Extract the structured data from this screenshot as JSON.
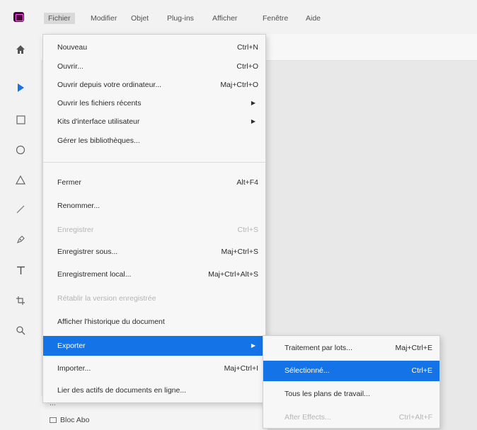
{
  "menubar": {
    "items": [
      "Fichier",
      "Modifier",
      "Objet",
      "Plug-ins",
      "Afficher",
      "Fenêtre",
      "Aide"
    ]
  },
  "tools": [
    "home-icon",
    "select-arrow-icon",
    "rectangle-icon",
    "ellipse-icon",
    "polygon-icon",
    "line-icon",
    "pen-icon",
    "text-icon",
    "artboard-icon",
    "zoom-icon"
  ],
  "layers": {
    "partial": "...",
    "item": "Bloc Abo"
  },
  "file_menu": {
    "items": [
      {
        "label": "Nouveau",
        "shortcut": "Ctrl+N"
      },
      {
        "label": "Ouvrir...",
        "shortcut": "Ctrl+O"
      },
      {
        "label": "Ouvrir depuis votre ordinateur...",
        "shortcut": "Maj+Ctrl+O"
      },
      {
        "label": "Ouvrir les fichiers récents",
        "shortcut": ""
      },
      {
        "label": "Kits d'interface utilisateur",
        "shortcut": ""
      },
      {
        "label": "Gérer les bibliothèques...",
        "shortcut": ""
      },
      {
        "label": "Fermer",
        "shortcut": "Alt+F4"
      },
      {
        "label": "Renommer...",
        "shortcut": ""
      },
      {
        "label": "Enregistrer",
        "shortcut": "Ctrl+S"
      },
      {
        "label": "Enregistrer sous...",
        "shortcut": "Maj+Ctrl+S"
      },
      {
        "label": "Enregistrement local...",
        "shortcut": "Maj+Ctrl+Alt+S"
      },
      {
        "label": "Rétablir la version enregistrée",
        "shortcut": ""
      },
      {
        "label": "Afficher l'historique du document",
        "shortcut": ""
      },
      {
        "label": "Exporter",
        "shortcut": ""
      },
      {
        "label": "Importer...",
        "shortcut": "Maj+Ctrl+I"
      },
      {
        "label": "Lier des actifs de documents en ligne...",
        "shortcut": ""
      }
    ]
  },
  "export_submenu": {
    "items": [
      {
        "label": "Traitement par lots...",
        "shortcut": "Maj+Ctrl+E"
      },
      {
        "label": "Sélectionné...",
        "shortcut": "Ctrl+E"
      },
      {
        "label": "Tous les plans de travail...",
        "shortcut": ""
      },
      {
        "label": "After Effects...",
        "shortcut": "Ctrl+Alt+F"
      }
    ]
  },
  "colors": {
    "accent": "#1473e6",
    "app_logo": "#470137"
  }
}
